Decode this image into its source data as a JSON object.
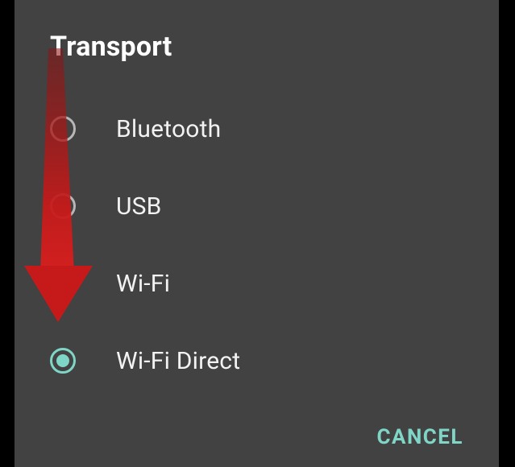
{
  "dialog": {
    "title": "Transport",
    "selected_index": 3,
    "options": [
      {
        "label": "Bluetooth",
        "selected": false
      },
      {
        "label": "USB",
        "selected": false
      },
      {
        "label": "Wi-Fi",
        "selected": false
      },
      {
        "label": "Wi-Fi Direct",
        "selected": true
      }
    ],
    "actions": {
      "cancel_label": "CANCEL"
    }
  },
  "colors": {
    "dialog_bg": "#424242",
    "text": "#f2f2f2",
    "accent": "#7fd6c7",
    "radio_unselected": "#b7b7b7",
    "annotation_arrow": "#c61a1a"
  },
  "annotation": {
    "arrow_points_to_option_index": 3
  }
}
